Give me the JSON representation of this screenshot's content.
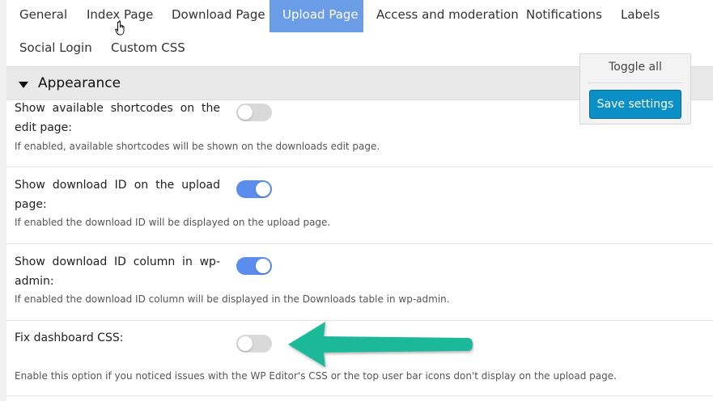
{
  "tabs": [
    {
      "label": "General"
    },
    {
      "label": "Index Page"
    },
    {
      "label": "Download Page"
    },
    {
      "label": "Upload Page",
      "active": true
    },
    {
      "label": "Access and moderation"
    },
    {
      "label": "Notifications"
    },
    {
      "label": "Labels"
    },
    {
      "label": "Social Login"
    },
    {
      "label": "Custom CSS"
    }
  ],
  "section": {
    "title": "Appearance",
    "expanded": true
  },
  "settings_box": {
    "toggle_all_label": "Toggle all",
    "save_label": "Save settings"
  },
  "settings": [
    {
      "label": "Show available shortcodes on the edit page:",
      "enabled": false,
      "description": "If enabled, available shortcodes will be shown on the downloads edit page."
    },
    {
      "label": "Show download ID on the upload page:",
      "enabled": true,
      "description": "If enabled the download ID will be displayed on the upload page."
    },
    {
      "label": "Show download ID column in wp-admin:",
      "enabled": true,
      "description": "If enabled the download ID column will be displayed in the Downloads table in wp-admin."
    },
    {
      "label": "Fix dashboard CSS:",
      "enabled": false,
      "description": "Enable this option if you noticed issues with the WP Editor's CSS or the top user bar icons don't display on the upload page."
    }
  ],
  "colors": {
    "active_tab": "#6b9ce6",
    "toggle_on": "#5b8def",
    "toggle_off": "#d9d9d9",
    "save_button": "#0a8fc7",
    "annotation_arrow": "#1fb89a"
  },
  "icons": {
    "section_caret": "caret-down-icon",
    "cursor": "hand-pointer-icon",
    "annotation": "arrow-left-icon"
  }
}
